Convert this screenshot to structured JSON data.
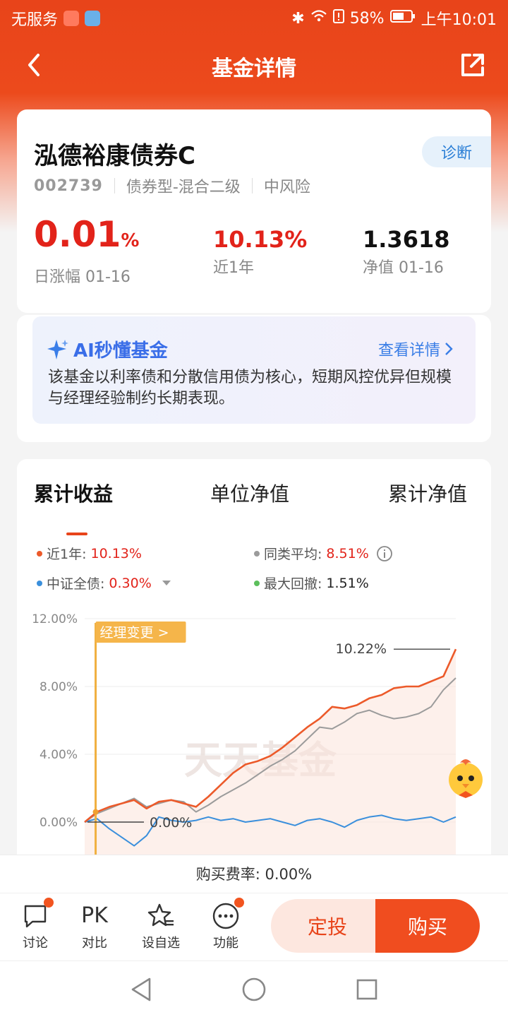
{
  "status": {
    "carrier": "无服务",
    "battery": "58%",
    "time": "上午10:01"
  },
  "nav": {
    "title": "基金详情"
  },
  "fund": {
    "name": "泓德裕康债券C",
    "code": "002739",
    "type": "债券型-混合二级",
    "risk": "中风险",
    "diagnose_label": "诊断",
    "daily_change": "0.01",
    "daily_change_unit": "%",
    "daily_label": "日涨幅 01-16",
    "year_return": "10.13%",
    "year_label": "近1年",
    "nav_value": "1.3618",
    "nav_label": "净值 01-16"
  },
  "ai": {
    "title": "AI秒懂基金",
    "more": "查看详情",
    "text": "该基金以利率债和分散信用债为核心，短期风控优异但规模与经理经验制约长期表现。"
  },
  "chart_tabs": [
    "累计收益",
    "单位净值",
    "累计净值"
  ],
  "legend": {
    "near_year_label": "近1年:",
    "near_year_value": "10.13%",
    "peer_avg_label": "同类平均:",
    "peer_avg_value": "8.51%",
    "index_label": "中证全债:",
    "index_value": "0.30%",
    "drawdown_label": "最大回撤:",
    "drawdown_value": "1.51%"
  },
  "chart_data": {
    "type": "line",
    "y_ticks": [
      "12.00%",
      "8.00%",
      "4.00%",
      "0.00%"
    ],
    "ylim": [
      -2,
      12
    ],
    "annotations": {
      "manager_change": "经理变更 >",
      "end_value": "10.22%",
      "start_value": "0.00%",
      "watermark": "天天基金"
    },
    "series": [
      {
        "name": "近1年",
        "color": "#ec5a2a",
        "values": [
          0,
          0.6,
          0.9,
          1.1,
          1.3,
          0.8,
          1.2,
          1.3,
          1.1,
          0.9,
          1.5,
          2.2,
          2.9,
          3.4,
          3.6,
          3.9,
          4.4,
          5.0,
          5.6,
          6.1,
          6.8,
          6.7,
          6.9,
          7.3,
          7.5,
          7.9,
          8.0,
          8.0,
          8.3,
          8.6,
          10.2
        ]
      },
      {
        "color": "#9b9b9b",
        "values": [
          0,
          0.5,
          0.8,
          1.1,
          1.4,
          0.9,
          1.1,
          1.3,
          1.2,
          0.6,
          1.0,
          1.5,
          1.9,
          2.3,
          2.8,
          3.3,
          3.7,
          4.2,
          4.9,
          5.6,
          5.5,
          5.9,
          6.4,
          6.6,
          6.3,
          6.1,
          6.2,
          6.4,
          6.8,
          7.8,
          8.5
        ]
      },
      {
        "color": "#3a8fdc",
        "values": [
          0,
          0.2,
          -0.4,
          -0.9,
          -1.4,
          -0.8,
          0.3,
          0.1,
          0.0,
          0.1,
          0.3,
          0.1,
          0.2,
          0.0,
          0.1,
          0.2,
          0.0,
          -0.2,
          0.1,
          0.2,
          0.0,
          -0.3,
          0.1,
          0.3,
          0.4,
          0.2,
          0.1,
          0.2,
          0.3,
          0.0,
          0.3
        ]
      }
    ]
  },
  "fee": {
    "text": "购买费率: 0.00%"
  },
  "bottom": {
    "discuss": "讨论",
    "pk_icon_text": "PK",
    "compare": "对比",
    "watchlist": "设自选",
    "functions": "功能",
    "dingtou": "定投",
    "buy": "购买"
  }
}
